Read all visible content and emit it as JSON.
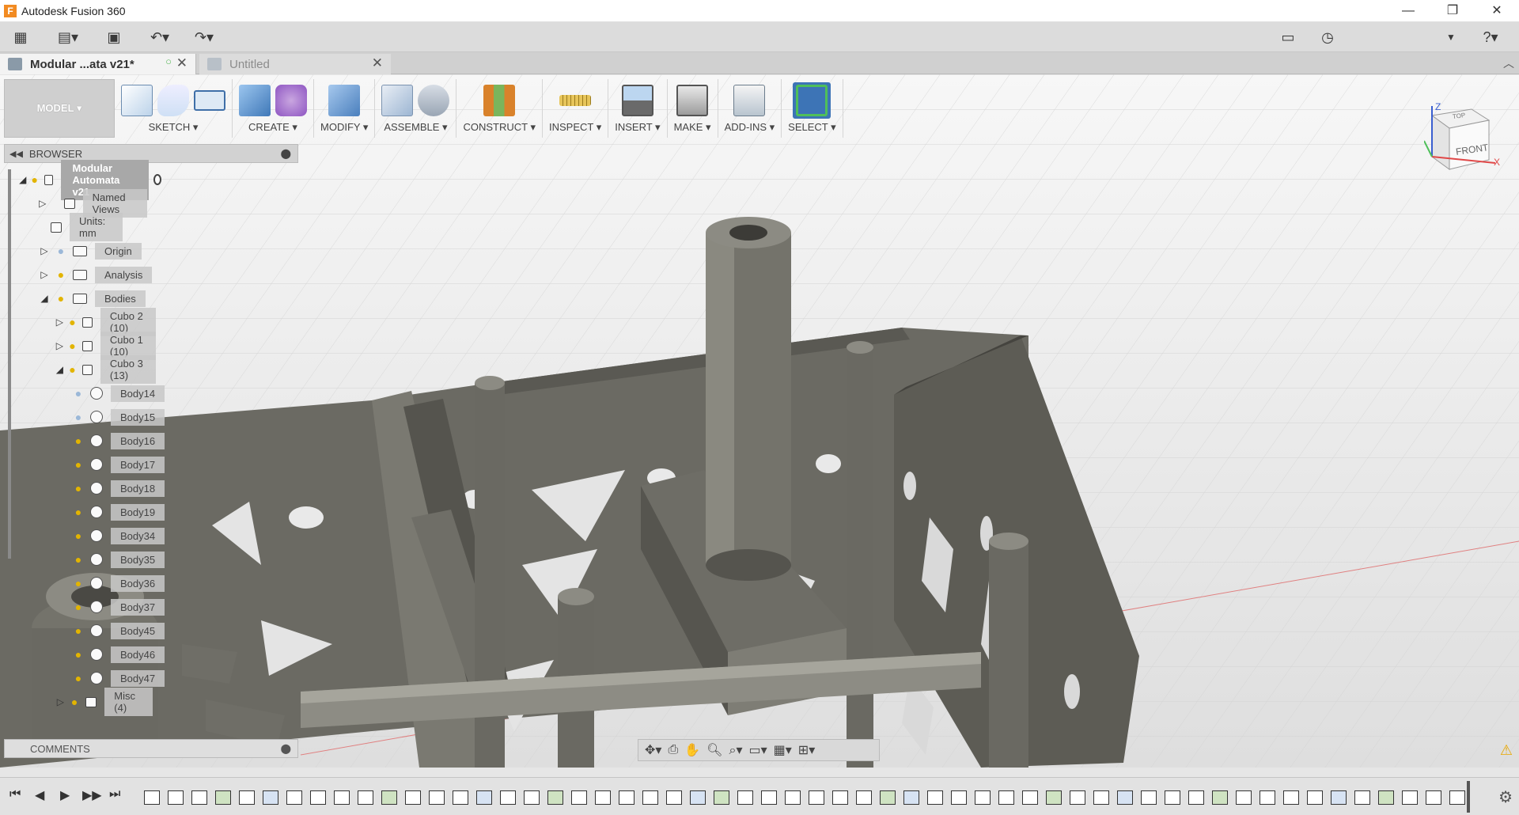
{
  "window": {
    "title": "Autodesk Fusion 360",
    "logo": "F",
    "minimize": "—",
    "restore": "❐",
    "close": "✕"
  },
  "quickbar": {
    "apps_icon": "grid-icon",
    "file_icon": "file-icon",
    "save_icon": "save-icon",
    "undo_icon": "undo-icon",
    "redo_icon": "redo-icon",
    "notifications_icon": "comment-icon",
    "history_icon": "clock-icon",
    "help_icon": "help-icon"
  },
  "tabs": [
    {
      "label": "Modular ...ata v21*",
      "active": true
    },
    {
      "label": "Untitled",
      "active": false
    }
  ],
  "toolbar": {
    "mode": "MODEL ▾",
    "groups": [
      {
        "label": "SKETCH ▾",
        "icons": [
          "sketch-icon",
          "line-icon",
          "rectangle-icon"
        ]
      },
      {
        "label": "CREATE ▾",
        "icons": [
          "extrude-icon",
          "form-icon"
        ]
      },
      {
        "label": "MODIFY ▾",
        "icons": [
          "press-pull-icon"
        ]
      },
      {
        "label": "ASSEMBLE ▾",
        "icons": [
          "new-component-icon",
          "joint-icon"
        ]
      },
      {
        "label": "CONSTRUCT ▾",
        "icons": [
          "plane-icon"
        ]
      },
      {
        "label": "INSPECT ▾",
        "icons": [
          "measure-icon"
        ]
      },
      {
        "label": "INSERT ▾",
        "icons": [
          "insert-image-icon"
        ]
      },
      {
        "label": "MAKE ▾",
        "icons": [
          "print-icon"
        ]
      },
      {
        "label": "ADD-INS ▾",
        "icons": [
          "scripts-icon"
        ]
      },
      {
        "label": "SELECT ▾",
        "icons": [
          "select-icon"
        ]
      }
    ]
  },
  "browser": {
    "title": "BROWSER",
    "root": "Modular Automata v21",
    "items": [
      {
        "label": "Named Views",
        "arrow": "▷",
        "bulb": "none",
        "icon": "folder"
      },
      {
        "label": "Units: mm",
        "arrow": "",
        "bulb": "none",
        "icon": "doc"
      },
      {
        "label": "Origin",
        "arrow": "▷",
        "bulb": "off",
        "icon": "folder"
      },
      {
        "label": "Analysis",
        "arrow": "▷",
        "bulb": "on",
        "icon": "folder"
      },
      {
        "label": "Bodies",
        "arrow": "◢",
        "bulb": "on",
        "icon": "folder"
      },
      {
        "label": "Cubo 2 (10)",
        "arrow": "▷",
        "bulb": "on",
        "icon": "folder"
      },
      {
        "label": "Cubo 1 (10)",
        "arrow": "▷",
        "bulb": "on",
        "icon": "folder"
      },
      {
        "label": "Cubo 3 (13)",
        "arrow": "◢",
        "bulb": "on",
        "icon": "folder"
      },
      {
        "label": "Body14",
        "arrow": "",
        "bulb": "off",
        "icon": "body"
      },
      {
        "label": "Body15",
        "arrow": "",
        "bulb": "off",
        "icon": "body"
      },
      {
        "label": "Body16",
        "arrow": "",
        "bulb": "on",
        "icon": "body"
      },
      {
        "label": "Body17",
        "arrow": "",
        "bulb": "on",
        "icon": "body"
      },
      {
        "label": "Body18",
        "arrow": "",
        "bulb": "on",
        "icon": "body"
      },
      {
        "label": "Body19",
        "arrow": "",
        "bulb": "on",
        "icon": "body"
      },
      {
        "label": "Body34",
        "arrow": "",
        "bulb": "on",
        "icon": "body"
      },
      {
        "label": "Body35",
        "arrow": "",
        "bulb": "on",
        "icon": "body"
      },
      {
        "label": "Body36",
        "arrow": "",
        "bulb": "on",
        "icon": "body"
      },
      {
        "label": "Body37",
        "arrow": "",
        "bulb": "on",
        "icon": "body"
      },
      {
        "label": "Body45",
        "arrow": "",
        "bulb": "on",
        "icon": "body"
      },
      {
        "label": "Body46",
        "arrow": "",
        "bulb": "on",
        "icon": "body"
      },
      {
        "label": "Body47",
        "arrow": "",
        "bulb": "on",
        "icon": "body"
      },
      {
        "label": "Misc (4)",
        "arrow": "▷",
        "bulb": "on",
        "icon": "folder"
      }
    ]
  },
  "comments": {
    "title": "COMMENTS"
  },
  "viewcube": {
    "face": "FRONT",
    "top": "TOP",
    "axis_z": "Z",
    "axis_x": "X"
  },
  "navbar": {
    "icons": [
      "orbit-icon",
      "look-at-icon",
      "pan-icon",
      "zoom-icon",
      "fit-icon",
      "display-settings-icon",
      "grid-icon",
      "viewports-icon"
    ]
  },
  "timeline": {
    "controls": [
      "⏮",
      "◀",
      "▶",
      "▶▶",
      "⏭"
    ],
    "feature_count": 56
  }
}
